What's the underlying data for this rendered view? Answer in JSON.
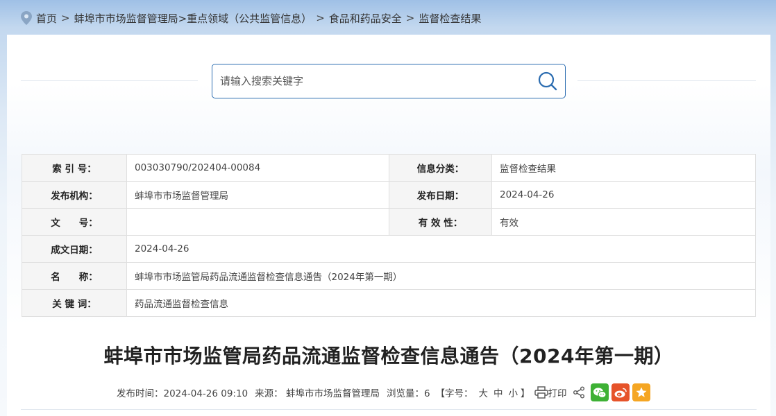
{
  "breadcrumb": {
    "home": "首页",
    "sep": ">",
    "bureau": "蚌埠市市场监督管理局",
    "key_area": ">重点领域（公共监管信息）",
    "food_drug": "食品和药品安全",
    "current": "监督检查结果"
  },
  "search": {
    "placeholder": "请输入搜索关键字"
  },
  "info_table": {
    "index_label": "索 引 号：",
    "index_value": "003030790/202404-00084",
    "category_label": "信息分类：",
    "category_value": "监督检查结果",
    "org_label": "发布机构：",
    "org_value": "蚌埠市市场监督管理局",
    "pubdate_label": "发布日期：",
    "pubdate_value": "2024-04-26",
    "docno_label": "文　　号：",
    "docno_value": "",
    "validity_label": "有 效 性：",
    "validity_value": "有效",
    "created_label": "成文日期：",
    "created_value": "2024-04-26",
    "name_label": "名　　称：",
    "name_value": "蚌埠市市场监管局药品流通监督检查信息通告（2024年第一期）",
    "keywords_label": "关 键 词：",
    "keywords_value": "药品流通监督检查信息"
  },
  "article": {
    "title": "蚌埠市市场监管局药品流通监督检查信息通告（2024年第一期）"
  },
  "meta": {
    "publish_time": "发布时间：2024-04-26 09:10",
    "source": "来源： 蚌埠市市场监督管理局",
    "views": "浏览量：6",
    "fontsize_open": "【字号：",
    "font_large": "大",
    "font_medium": "中",
    "font_small": "小",
    "fontsize_close": "】",
    "print": "打印"
  },
  "colors": {
    "accent": "#2b6cb0",
    "wechat": "#3eb135",
    "weibo": "#e6532a",
    "favorite": "#f5a623"
  },
  "icons": [
    "location-pin-icon",
    "search-icon",
    "print-icon",
    "share-icon",
    "wechat-icon",
    "weibo-icon",
    "star-icon"
  ]
}
